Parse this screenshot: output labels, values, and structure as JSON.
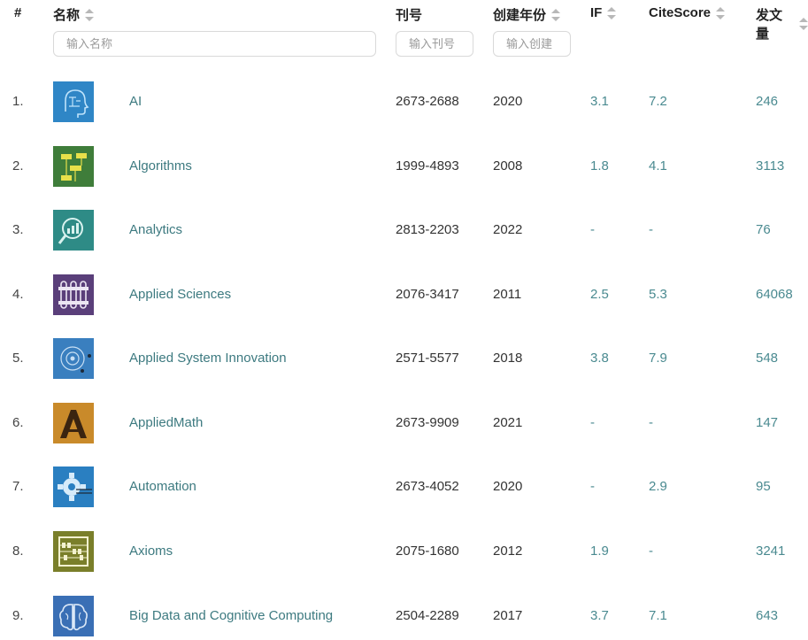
{
  "header": {
    "index": "#",
    "name": "名称",
    "issn": "刊号",
    "year": "创建年份",
    "if": "IF",
    "citescore": "CiteScore",
    "articles": "发文量"
  },
  "filters": {
    "name_placeholder": "输入名称",
    "issn_placeholder": "输入刊号",
    "year_placeholder": "输入创建"
  },
  "rows": [
    {
      "index": "1.",
      "name": "AI",
      "issn": "2673-2688",
      "year": "2020",
      "if": "3.1",
      "citescore": "7.2",
      "articles": "246",
      "logo_color": "#2f86c6",
      "logo_icon": "head-circuit-icon"
    },
    {
      "index": "2.",
      "name": "Algorithms",
      "issn": "1999-4893",
      "year": "2008",
      "if": "1.8",
      "citescore": "4.1",
      "articles": "3113",
      "logo_color": "#3f7d3a",
      "logo_icon": "flowchart-icon"
    },
    {
      "index": "3.",
      "name": "Analytics",
      "issn": "2813-2203",
      "year": "2022",
      "if": "-",
      "citescore": "-",
      "articles": "76",
      "logo_color": "#2e8b86",
      "logo_icon": "magnifier-chart-icon"
    },
    {
      "index": "4.",
      "name": "Applied Sciences",
      "issn": "2076-3417",
      "year": "2011",
      "if": "2.5",
      "citescore": "5.3",
      "articles": "64068",
      "logo_color": "#5a3f7a",
      "logo_icon": "test-tubes-icon"
    },
    {
      "index": "5.",
      "name": "Applied System Innovation",
      "issn": "2571-5577",
      "year": "2018",
      "if": "3.8",
      "citescore": "7.9",
      "articles": "548",
      "logo_color": "#3a7fbf",
      "logo_icon": "orbit-icon"
    },
    {
      "index": "6.",
      "name": "AppliedMath",
      "issn": "2673-9909",
      "year": "2021",
      "if": "-",
      "citescore": "-",
      "articles": "147",
      "logo_color": "#c98a2a",
      "logo_icon": "lambda-icon"
    },
    {
      "index": "7.",
      "name": "Automation",
      "issn": "2673-4052",
      "year": "2020",
      "if": "-",
      "citescore": "2.9",
      "articles": "95",
      "logo_color": "#2a7fc1",
      "logo_icon": "gear-icon"
    },
    {
      "index": "8.",
      "name": "Axioms",
      "issn": "2075-1680",
      "year": "2012",
      "if": "1.9",
      "citescore": "-",
      "articles": "3241",
      "logo_color": "#7a7f2a",
      "logo_icon": "abacus-icon"
    },
    {
      "index": "9.",
      "name": "Big Data and Cognitive Computing",
      "issn": "2504-2289",
      "year": "2017",
      "if": "3.7",
      "citescore": "7.1",
      "articles": "643",
      "logo_color": "#3a6fb5",
      "logo_icon": "brain-icon"
    }
  ]
}
